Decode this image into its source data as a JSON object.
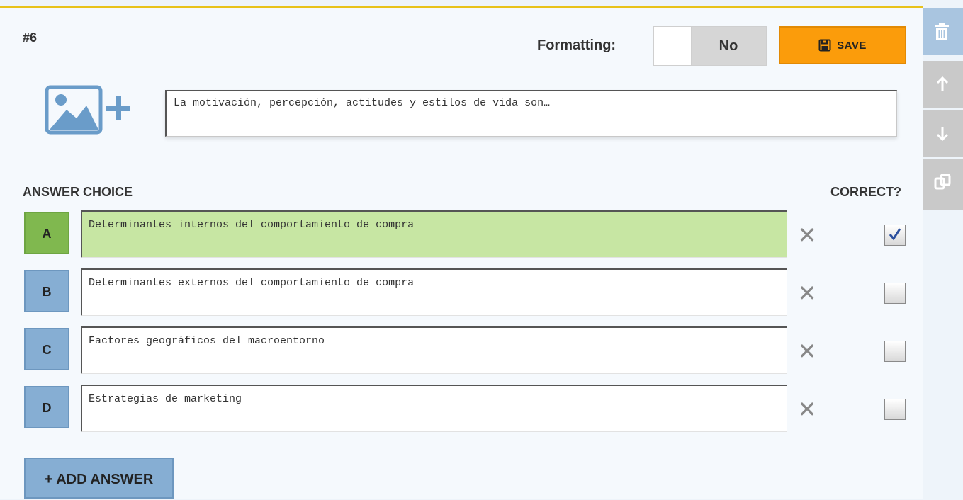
{
  "question": {
    "number": "#6",
    "text": "La motivación, percepción, actitudes y estilos de vida son…"
  },
  "formatting": {
    "label": "Formatting:",
    "value": "No"
  },
  "save_button": {
    "label": "SAVE"
  },
  "headers": {
    "answer_choice": "ANSWER CHOICE",
    "correct": "CORRECT?"
  },
  "answers": [
    {
      "letter": "A",
      "text": "Determinantes internos del comportamiento de compra",
      "correct": true
    },
    {
      "letter": "B",
      "text": "Determinantes externos del comportamiento de compra",
      "correct": false
    },
    {
      "letter": "C",
      "text": "Factores geográficos del macroentorno",
      "correct": false
    },
    {
      "letter": "D",
      "text": "Estrategias de marketing",
      "correct": false
    }
  ],
  "add_answer_button": {
    "label": "+ ADD ANSWER"
  },
  "side_toolbar": [
    {
      "icon": "trash-icon"
    },
    {
      "icon": "arrow-up-icon"
    },
    {
      "icon": "arrow-down-icon"
    },
    {
      "icon": "duplicate-icon"
    }
  ],
  "colors": {
    "accent_top_border": "#e8c21a",
    "save": "#fb9c0b",
    "letter_box": "#86aed3",
    "correct_letter": "#80b84f",
    "correct_answer_bg": "#c7e6a3",
    "side_toolbar": "#a9c5e0",
    "side_toolbar_disabled": "#c9c9c9"
  }
}
